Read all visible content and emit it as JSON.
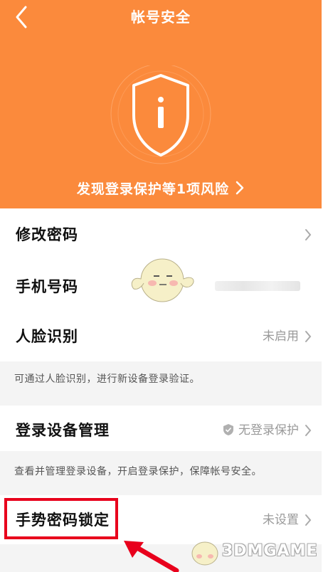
{
  "header": {
    "title": "帐号安全",
    "risk_text": "发现登录保护等1项风险",
    "background_color": "#fb8a3c"
  },
  "rows": {
    "change_password": {
      "label": "修改密码"
    },
    "phone_number": {
      "label": "手机号码"
    },
    "face_recognition": {
      "label": "人脸识别",
      "value": "未启用"
    },
    "device_management": {
      "label": "登录设备管理",
      "value": "无登录保护"
    },
    "gesture_lock": {
      "label": "手势密码锁定",
      "value": "未设置"
    }
  },
  "notes": {
    "face_recognition": "可通过人脸识别，进行新设备登录验证。",
    "device_management": "查看并管理登录设备，开启登录保护，保障帐号安全。"
  },
  "watermark": {
    "text": "3DMGAME"
  },
  "icons": {
    "back": "chevron-left-icon",
    "shield": "shield-info-icon",
    "arrow": "chevron-right-icon",
    "device_shield": "shield-check-icon"
  },
  "colors": {
    "highlight": "#e8001c",
    "accent": "#fb8a3c"
  }
}
